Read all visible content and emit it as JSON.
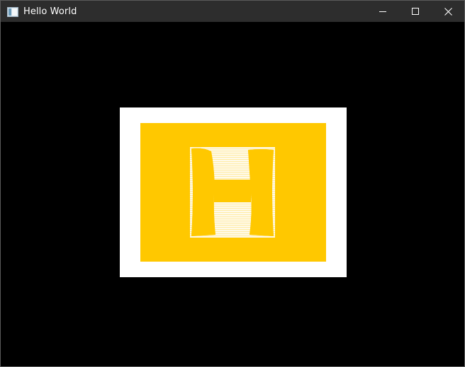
{
  "window": {
    "title": "Hello World"
  },
  "icons": {
    "app": "app-window-icon",
    "minimize": "minimize-icon",
    "maximize": "maximize-icon",
    "close": "close-icon"
  },
  "canvas": {
    "background": "#000000",
    "frame_color": "#ffffff",
    "fill_color": "#ffc800",
    "letter": "H"
  }
}
